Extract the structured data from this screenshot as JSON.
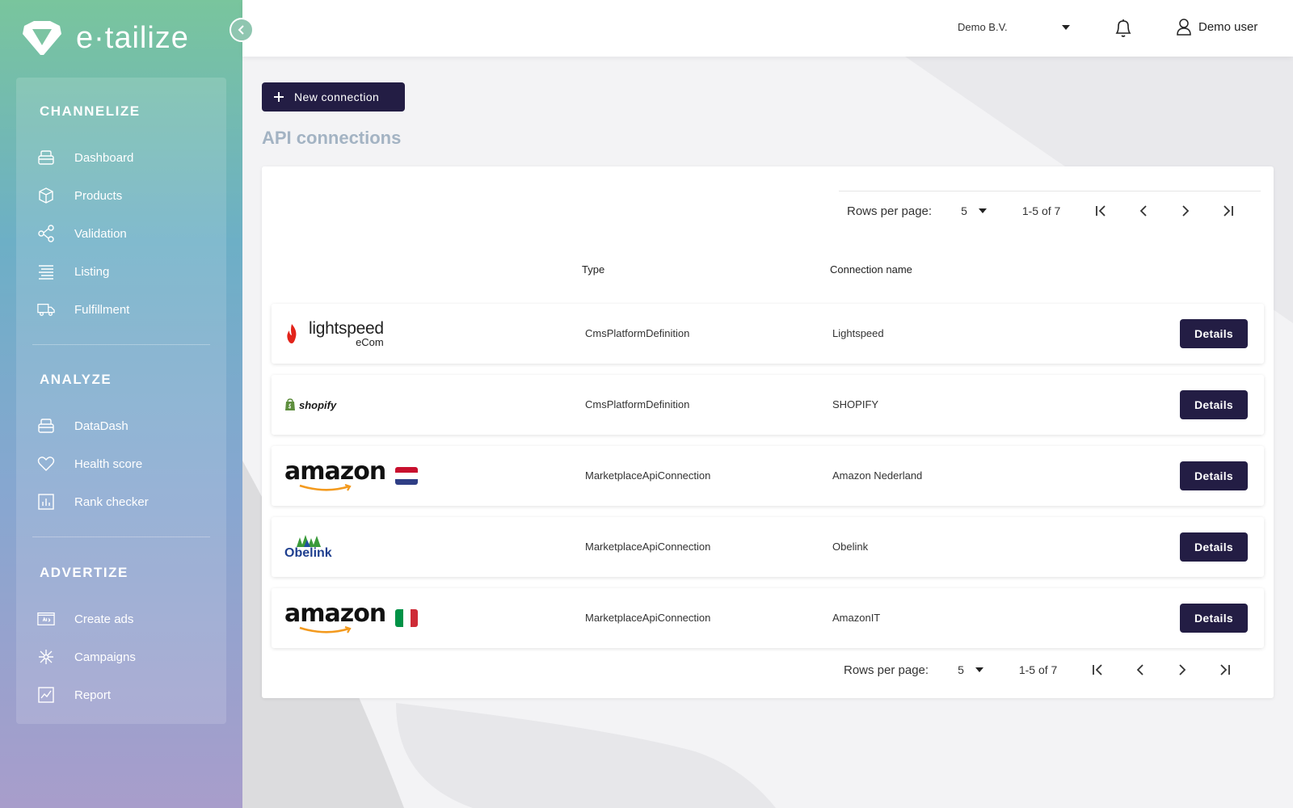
{
  "brand": {
    "name": "e·tailize"
  },
  "sidebar": {
    "sections": [
      {
        "title": "CHANNELIZE",
        "items": [
          {
            "label": "Dashboard",
            "icon": "dashboard-icon"
          },
          {
            "label": "Products",
            "icon": "box-icon"
          },
          {
            "label": "Validation",
            "icon": "share-icon"
          },
          {
            "label": "Listing",
            "icon": "list-icon"
          },
          {
            "label": "Fulfillment",
            "icon": "truck-icon"
          }
        ]
      },
      {
        "title": "ANALYZE",
        "items": [
          {
            "label": "DataDash",
            "icon": "dashboard-icon"
          },
          {
            "label": "Health score",
            "icon": "heart-icon"
          },
          {
            "label": "Rank checker",
            "icon": "bar-chart-icon"
          }
        ]
      },
      {
        "title": "ADVERTIZE",
        "items": [
          {
            "label": "Create ads",
            "icon": "ads-icon"
          },
          {
            "label": "Campaigns",
            "icon": "network-icon"
          },
          {
            "label": "Report",
            "icon": "report-icon"
          }
        ]
      }
    ]
  },
  "topbar": {
    "company": "Demo B.V.",
    "user": "Demo user"
  },
  "main": {
    "new_button": "New connection",
    "title": "API connections",
    "pager": {
      "rows_label": "Rows per page:",
      "rows_value": "5",
      "range": "1-5 of 7"
    },
    "columns": {
      "type": "Type",
      "connection_name": "Connection name"
    },
    "details_label": "Details",
    "rows": [
      {
        "logo": "lightspeed",
        "logo_text": "lightspeed",
        "logo_sub": "eCom",
        "type": "CmsPlatformDefinition",
        "name": "Lightspeed"
      },
      {
        "logo": "shopify",
        "logo_text": "shopify",
        "type": "CmsPlatformDefinition",
        "name": "SHOPIFY"
      },
      {
        "logo": "amazon-nl",
        "logo_text": "amazon",
        "type": "MarketplaceApiConnection",
        "name": "Amazon Nederland"
      },
      {
        "logo": "obelink",
        "logo_text": "Obelink",
        "type": "MarketplaceApiConnection",
        "name": "Obelink"
      },
      {
        "logo": "amazon-it",
        "logo_text": "amazon",
        "type": "MarketplaceApiConnection",
        "name": "AmazonIT"
      }
    ]
  },
  "colors": {
    "primary": "#231d44",
    "title": "#a3b3c3"
  }
}
